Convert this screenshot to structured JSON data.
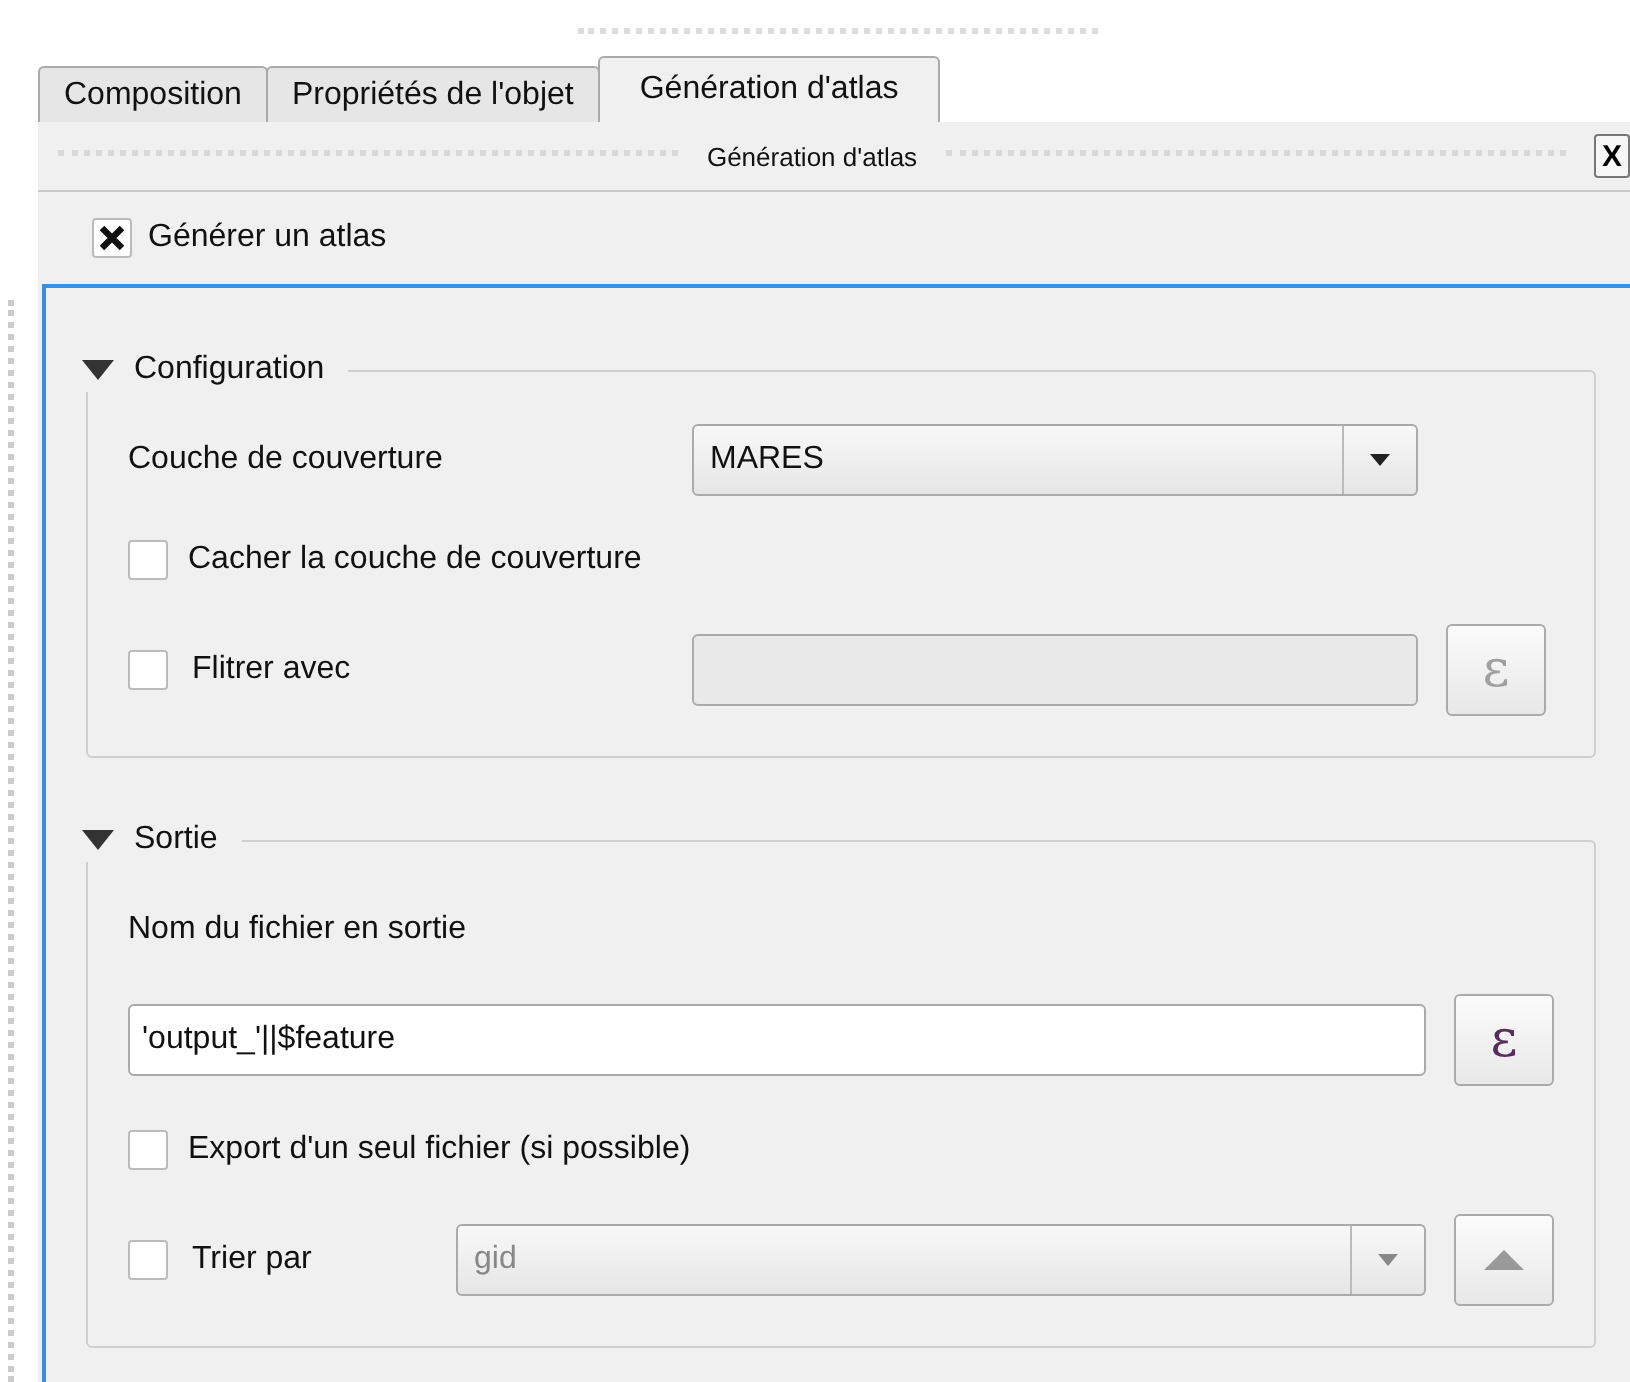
{
  "tabs": [
    {
      "label": "Composition",
      "selected": false
    },
    {
      "label": "Propriétés de l'objet",
      "selected": false
    },
    {
      "label": "Génération d'atlas",
      "selected": true
    }
  ],
  "dock": {
    "title": "Génération d'atlas",
    "close": "X"
  },
  "atlas": {
    "label": "Générer un atlas",
    "checked": true
  },
  "groups": [
    {
      "title": "Configuration",
      "expanded": true,
      "rows": [
        {
          "kind": "combo",
          "label": "Couche de couverture",
          "value": "MARES",
          "disabled": false
        },
        {
          "kind": "checkbox",
          "label": "Cacher la couche de couverture",
          "checked": false
        },
        {
          "kind": "check_field",
          "label": "Flitrer avec",
          "checked": false,
          "value": "",
          "button": "ε",
          "disabled": true
        }
      ]
    },
    {
      "title": "Sortie",
      "expanded": true,
      "rows": [
        {
          "kind": "label",
          "label": "Nom du fichier en sortie"
        },
        {
          "kind": "field",
          "value": "'output_'||$feature",
          "button": "ε",
          "disabled": false
        },
        {
          "kind": "checkbox",
          "label": "Export d'un seul fichier (si possible)",
          "checked": false
        },
        {
          "kind": "check_combo",
          "label": "Trier par",
          "checked": false,
          "value": "gid",
          "disabled": true
        }
      ]
    }
  ]
}
